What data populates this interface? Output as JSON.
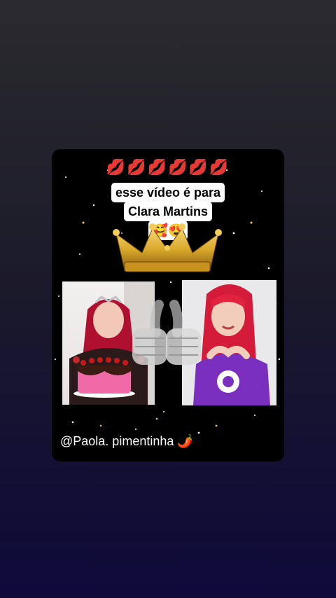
{
  "post": {
    "kiss_row": "💋💋💋💋💋💋",
    "caption_line1": "esse vídeo é para",
    "caption_line2": "Clara Martins",
    "caption_emojis": "🥰😍",
    "handle": "@Paola.  pimentinha 🌶️",
    "icons": {
      "crown": "crown-icon",
      "fist_bump": "fist-bump-icon"
    },
    "colors": {
      "card_bg": "#000000",
      "crown_gold": "#d9a92a",
      "hair_red": "#c8102e",
      "shirt_purple": "#7b2fbe"
    }
  }
}
